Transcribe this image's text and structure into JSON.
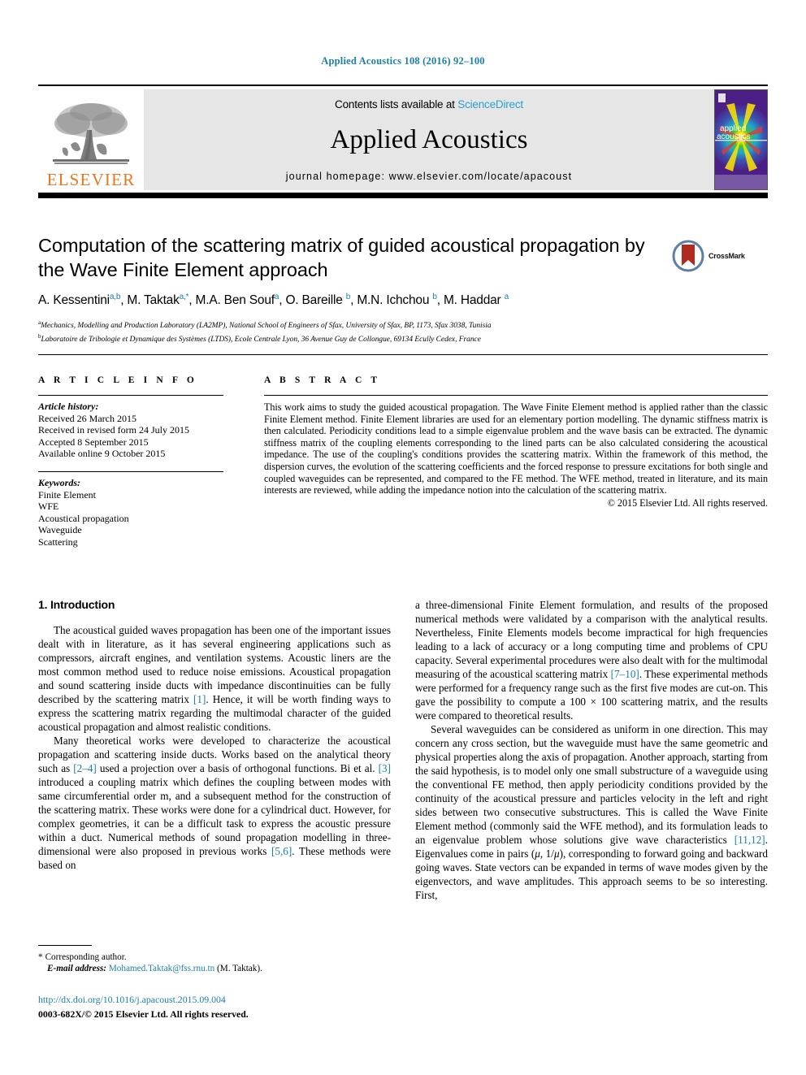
{
  "running_head": "Applied Acoustics 108 (2016) 92–100",
  "banner": {
    "publisher_logo_text": "ELSEVIER",
    "contents_prefix": "Contents lists available at ",
    "contents_link": "ScienceDirect",
    "journal_name": "Applied Acoustics",
    "homepage": "journal homepage: www.elsevier.com/locate/apacoust",
    "cover_title_line1": "applied",
    "cover_title_line2": "acoustics",
    "colors": {
      "link": "#2a9fd0",
      "elsevier_orange": "#E87722",
      "band": "#e6e6e6"
    }
  },
  "article": {
    "title": "Computation of the scattering matrix of guided acoustical propagation by the Wave Finite Element approach",
    "crossmark_label": "CrossMark",
    "authors": [
      {
        "name": "A. Kessentini",
        "marks": "a,b"
      },
      {
        "name": "M. Taktak",
        "marks": "a,*"
      },
      {
        "name": "M.A. Ben Souf",
        "marks": "a"
      },
      {
        "name": "O. Bareille",
        "marks": "b"
      },
      {
        "name": "M.N. Ichchou",
        "marks": "b"
      },
      {
        "name": "M. Haddar",
        "marks": "a"
      }
    ],
    "affiliations": [
      {
        "mark": "a",
        "text": "Mechanics, Modelling and Production Laboratory (LA2MP), National School of Engineers of Sfax, University of Sfax, BP, 1173, Sfax 3038, Tunisia"
      },
      {
        "mark": "b",
        "text": "Laboratoire de Tribologie et Dynamique des Systèmes (LTDS), Ecole Centrale Lyon, 36 Avenue Guy de Collongue, 69134 Ecully Cedex, France"
      }
    ]
  },
  "info": {
    "heading": "A R T I C L E   I N F O",
    "history_label": "Article history:",
    "history": [
      "Received 26 March 2015",
      "Received in revised form 24 July 2015",
      "Accepted 8 September 2015",
      "Available online 9 October 2015"
    ],
    "keywords_label": "Keywords:",
    "keywords": [
      "Finite Element",
      "WFE",
      "Acoustical propagation",
      "Waveguide",
      "Scattering"
    ]
  },
  "abstract": {
    "heading": "A B S T R A C T",
    "text": "This work aims to study the guided acoustical propagation. The Wave Finite Element method is applied rather than the classic Finite Element method. Finite Element libraries are used for an elementary portion modelling. The dynamic stiffness matrix is then calculated. Periodicity conditions lead to a simple eigenvalue problem and the wave basis can be extracted. The dynamic stiffness matrix of the coupling elements corresponding to the lined parts can be also calculated considering the acoustical impedance. The use of the coupling's conditions provides the scattering matrix. Within the framework of this method, the dispersion curves, the evolution of the scattering coefficients and the forced response to pressure excitations for both single and coupled waveguides can be represented, and compared to the FE method. The WFE method, treated in literature, and its main interests are reviewed, while adding the impedance notion into the calculation of the scattering matrix.",
    "copyright": "© 2015 Elsevier Ltd. All rights reserved."
  },
  "body": {
    "section_heading": "1. Introduction",
    "left_paragraphs": [
      "The acoustical guided waves propagation has been one of the important issues dealt with in literature, as it has several engineering applications such as compressors, aircraft engines, and ventilation systems. Acoustic liners are the most common method used to reduce noise emissions. Acoustical propagation and sound scattering inside ducts with impedance discontinuities can be fully described by the scattering matrix [1]. Hence, it will be worth finding ways to express the scattering matrix regarding the multimodal character of the guided acoustical propagation and almost realistic conditions.",
      "Many theoretical works were developed to characterize the acoustical propagation and scattering inside ducts. Works based on the analytical theory such as [2–4] used a projection over a basis of orthogonal functions. Bi et al. [3] introduced a coupling matrix which defines the coupling between modes with same circumferential order m, and a subsequent method for the construction of the scattering matrix. These works were done for a cylindrical duct. However, for complex geometries, it can be a difficult task to express the acoustic pressure within a duct. Numerical methods of sound propagation modelling in three-dimensional were also proposed in previous works [5,6]. These methods were based on"
    ],
    "right_paragraphs": [
      "a three-dimensional Finite Element formulation, and results of the proposed numerical methods were validated by a comparison with the analytical results. Nevertheless, Finite Elements models become impractical for high frequencies leading to a lack of accuracy or a long computing time and problems of CPU capacity. Several experimental procedures were also dealt with for the multimodal measuring of the acoustical scattering matrix [7–10]. These experimental methods were performed for a frequency range such as the first five modes are cut-on. This gave the possibility to compute a 100 × 100 scattering matrix, and the results were compared to theoretical results.",
      "Several waveguides can be considered as uniform in one direction. This may concern any cross section, but the waveguide must have the same geometric and physical properties along the axis of propagation. Another approach, starting from the said hypothesis, is to model only one small substructure of a waveguide using the conventional FE method, then apply periodicity conditions provided by the continuity of the acoustical pressure and particles velocity in the left and right sides between two consecutive substructures. This is called the Wave Finite Element method (commonly said the WFE method), and its formulation leads to an eigenvalue problem whose solutions give wave characteristics [11,12]. Eigenvalues come in pairs (μ, 1/μ), corresponding to forward going and backward going waves. State vectors can be expanded in terms of wave modes given by the eigenvectors, and wave amplitudes. This approach seems to be so interesting. First,"
    ]
  },
  "footnote": {
    "corresponding_marker": "*",
    "corresponding_text": "Corresponding author.",
    "email_label": "E-mail address:",
    "email": "Mohamed.Taktak@fss.rnu.tn",
    "email_suffix": "(M. Taktak)."
  },
  "footer": {
    "doi": "http://dx.doi.org/10.1016/j.apacoust.2015.09.004",
    "issn": "0003-682X/© 2015 Elsevier Ltd. All rights reserved."
  }
}
